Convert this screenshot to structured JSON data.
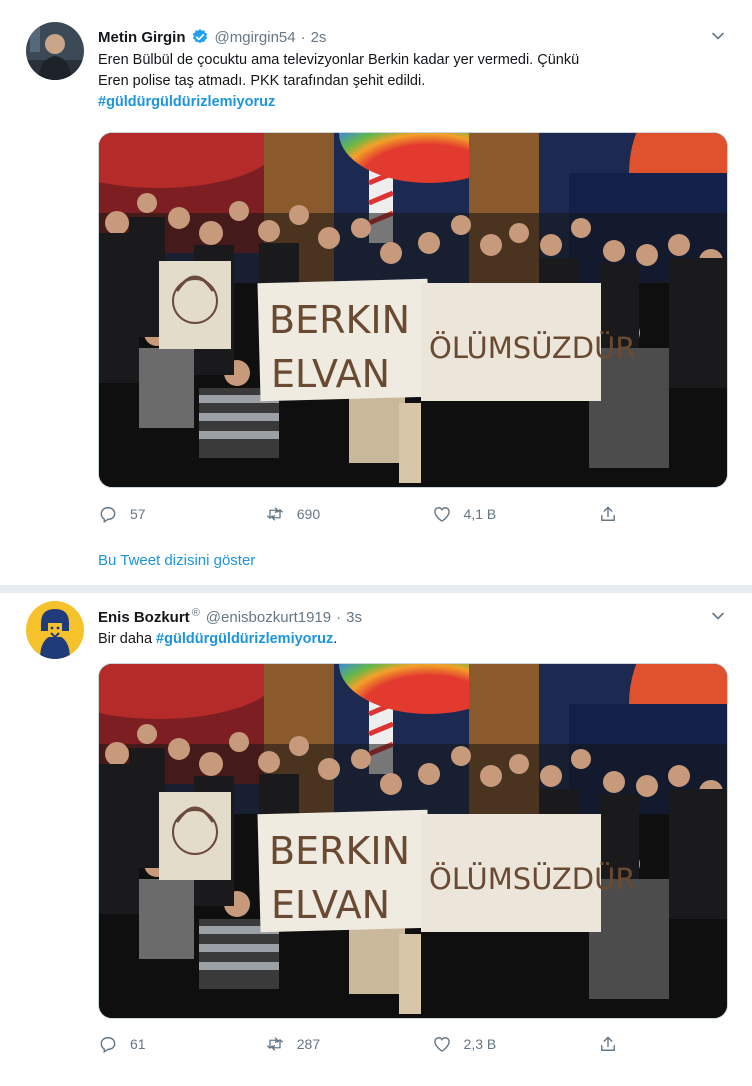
{
  "tweets": [
    {
      "author": "Metin Girgin",
      "handle": "@mgirgin54",
      "separator": "·",
      "time": "2s",
      "verified": true,
      "text_line1": "Eren Bülbül de çocuktu ama televizyonlar Berkin kadar yer vermedi. Çünkü",
      "text_line2": "Eren polise taş atmadı. PKK tarafından şehit edildi.",
      "hashtag": "#güldürgüldürizlemiyoruz",
      "sign_word1": "BERKIN",
      "sign_word2": "ELVAN",
      "sign_word3": "ÖLÜMSÜZDÜR",
      "stats": {
        "replies": "57",
        "retweets": "690",
        "likes": "4,1 B"
      }
    },
    {
      "author": "Enis Bozkurt",
      "handle": "@enisbozkurt1919",
      "separator": "·",
      "time": "3s",
      "badge": "®",
      "text_prefix": "Bir daha ",
      "hashtag": "#güldürgüldürizlemiyoruz",
      "text_suffix": ".",
      "sign_word1": "BERKIN",
      "sign_word2": "ELVAN",
      "sign_word3": "ÖLÜMSÜZDÜR",
      "stats": {
        "replies": "61",
        "retweets": "287",
        "likes": "2,3 B"
      }
    }
  ],
  "thread_link": "Bu Tweet dizisini göster",
  "colors": {
    "accent": "#1b95e0",
    "muted": "#657786",
    "divider": "#e6ecf0",
    "retweet": "#657786"
  },
  "icons": [
    "reply-icon",
    "retweet-icon",
    "like-icon",
    "share-icon",
    "verified-icon",
    "caret-down-icon"
  ]
}
